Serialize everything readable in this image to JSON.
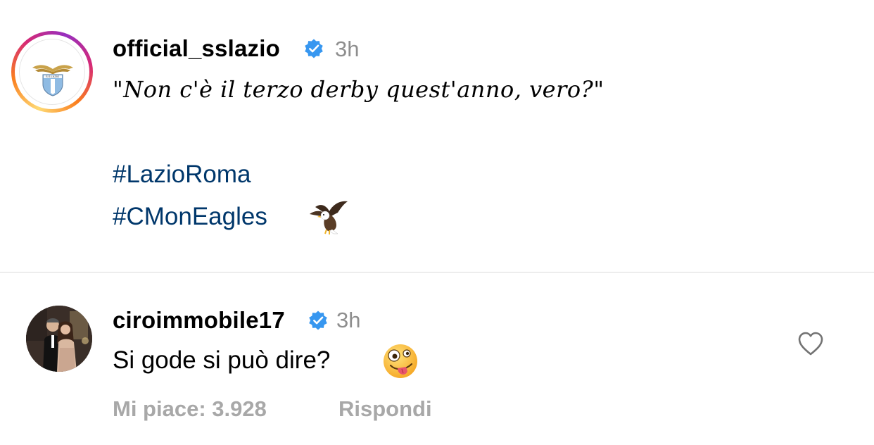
{
  "post": {
    "username": "official_sslazio",
    "time": "3h",
    "quote": "\"Non c'è il terzo derby quest'anno, vero?\"",
    "hashtags": [
      "#LazioRoma",
      "#CMonEagles"
    ],
    "logo_text": "S.S.LAZIO",
    "eagle_icon": "eagle-emoji",
    "verified_color": "#3797f0"
  },
  "comment": {
    "username": "ciroimmobile17",
    "time": "3h",
    "text": "Si gode si può dire?",
    "emoji": "zany-face-emoji",
    "likes_label": "Mi piace: 3.928",
    "reply_label": "Rispondi"
  }
}
